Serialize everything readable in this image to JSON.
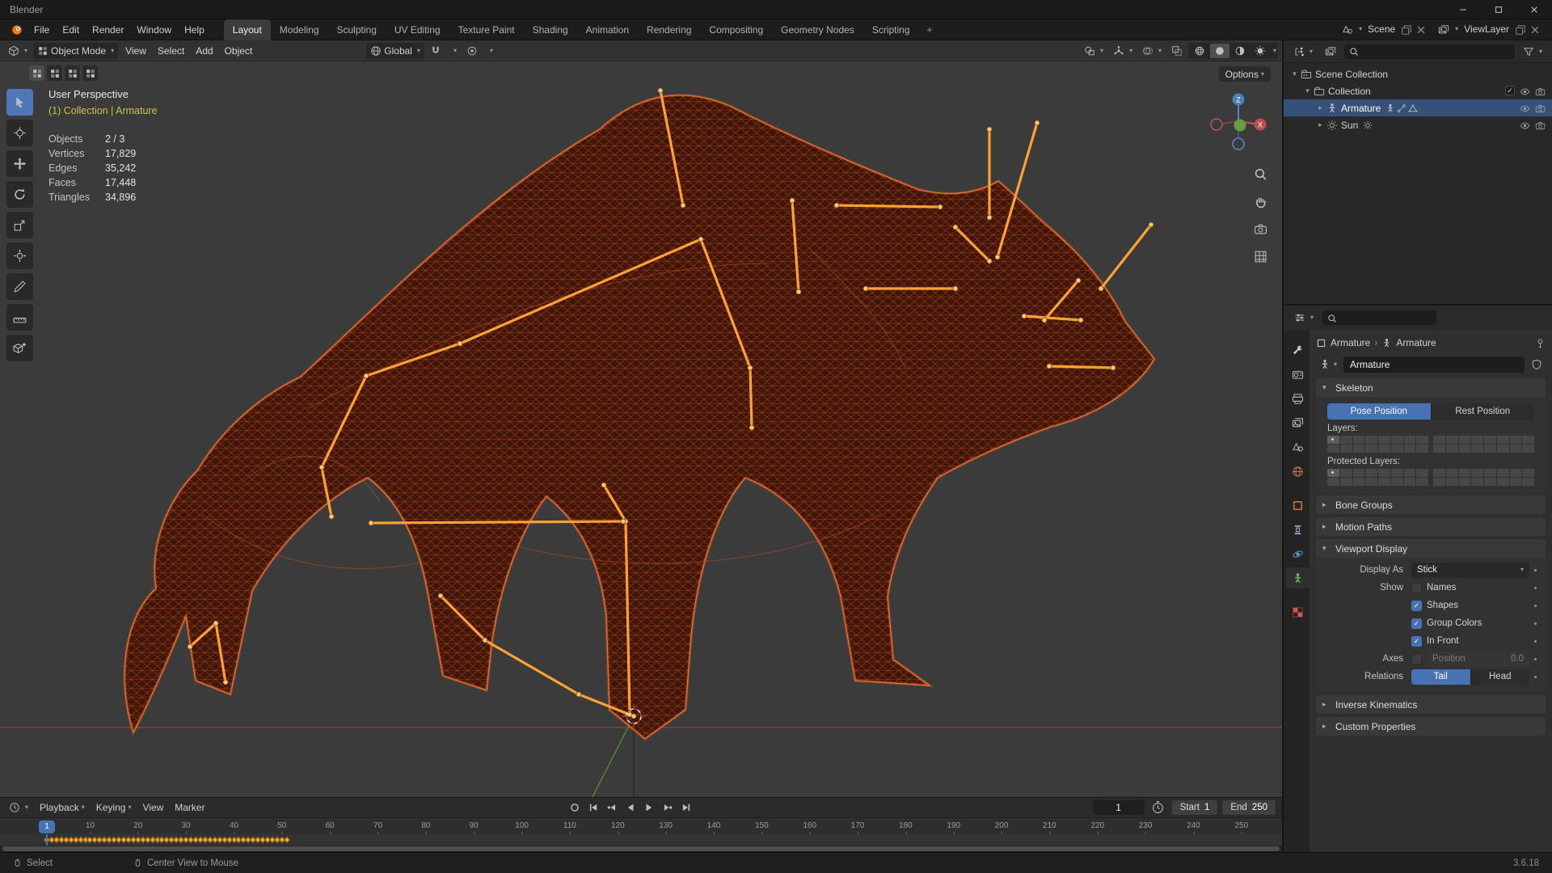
{
  "app": {
    "title": "Blender",
    "version": "3.6.18"
  },
  "colors": {
    "accent": "#4772b3",
    "wireframe": "#e0561f",
    "bone": "#ffa133",
    "context_highlight": "#cdc14c",
    "selection": "#35517a"
  },
  "topbar": {
    "menus": [
      "File",
      "Edit",
      "Render",
      "Window",
      "Help"
    ],
    "workspaces": [
      "Layout",
      "Modeling",
      "Sculpting",
      "UV Editing",
      "Texture Paint",
      "Shading",
      "Animation",
      "Rendering",
      "Compositing",
      "Geometry Nodes",
      "Scripting"
    ],
    "active_workspace": "Layout",
    "add_workspace_label": "+",
    "scene_selector": {
      "label": "Scene"
    },
    "viewlayer_selector": {
      "label": "ViewLayer"
    }
  },
  "viewport": {
    "header": {
      "mode": "Object Mode",
      "menus": [
        "View",
        "Select",
        "Add",
        "Object"
      ],
      "orientation": "Global",
      "options_label": "Options"
    },
    "overlay": {
      "view_name": "User Perspective",
      "context_path": "(1) Collection | Armature",
      "stats": [
        {
          "label": "Objects",
          "value": "2 / 3"
        },
        {
          "label": "Vertices",
          "value": "17,829"
        },
        {
          "label": "Edges",
          "value": "35,242"
        },
        {
          "label": "Faces",
          "value": "17,448"
        },
        {
          "label": "Triangles",
          "value": "34,896"
        }
      ]
    },
    "gizmo": {
      "z_label": "Z",
      "x_label": "X"
    },
    "tools": [
      "select-box",
      "cursor",
      "move",
      "rotate",
      "scale",
      "transform",
      "annotate",
      "measure",
      "add-cube"
    ],
    "active_tool": "select-box"
  },
  "outliner": {
    "rows": [
      {
        "label": "Scene Collection",
        "depth": 0,
        "icon": "scene-collection",
        "icon_color": "#d0d0d0",
        "caret": "down",
        "selected": false,
        "inline_icons": [],
        "controls": []
      },
      {
        "label": "Collection",
        "depth": 1,
        "icon": "collection",
        "icon_color": "#d0d0d0",
        "caret": "down",
        "selected": false,
        "inline_icons": [],
        "controls": [
          "checkbox",
          "eye",
          "camera"
        ]
      },
      {
        "label": "Armature",
        "depth": 2,
        "icon": "man",
        "icon_color": "#e8933a",
        "caret": "right",
        "selected": true,
        "inline_icons": [
          "man",
          "bone",
          "mesh-tri"
        ],
        "controls": [
          "eye",
          "camera"
        ]
      },
      {
        "label": "Sun",
        "depth": 2,
        "icon": "sun",
        "icon_color": "#cfae4a",
        "caret": "right",
        "selected": false,
        "inline_icons": [
          "sun"
        ],
        "controls": [
          "eye",
          "camera"
        ]
      }
    ]
  },
  "properties": {
    "breadcrumb": {
      "object": "Armature",
      "data": "Armature"
    },
    "name_value": "Armature",
    "tabs": [
      {
        "id": "tool",
        "icon": "wrench",
        "color": "#c6c6c6"
      },
      {
        "id": "render",
        "icon": "render-cam",
        "color": "#c6c6c6"
      },
      {
        "id": "output",
        "icon": "printer",
        "color": "#c6c6c6"
      },
      {
        "id": "view-layer",
        "icon": "photos",
        "color": "#c6c6c6"
      },
      {
        "id": "scene",
        "icon": "scene-ic",
        "color": "#c6c6c6"
      },
      {
        "id": "world",
        "icon": "globe",
        "color": "#cf7d52"
      },
      {
        "id": "object",
        "icon": "square",
        "color": "#e2873c",
        "gap": true
      },
      {
        "id": "constraints",
        "icon": "clamp",
        "color": "#aac6e4"
      },
      {
        "id": "physics",
        "icon": "orbit",
        "color": "#5e9dd4"
      },
      {
        "id": "data",
        "icon": "man",
        "color": "#6fc455",
        "active": true
      },
      {
        "id": "texture",
        "icon": "checker",
        "color": "#d4574e",
        "gap": true
      }
    ],
    "panels": {
      "skeleton": {
        "title": "Skeleton",
        "pose_label": "Pose Position",
        "rest_label": "Rest Position",
        "active_position": "Pose Position",
        "layers_label": "Layers:",
        "protected_layers_label": "Protected Layers:"
      },
      "bone_groups": {
        "title": "Bone Groups"
      },
      "motion_paths": {
        "title": "Motion Paths"
      },
      "viewport_display": {
        "title": "Viewport Display",
        "display_as_label": "Display As",
        "display_as_value": "Stick",
        "show_label": "Show",
        "checkboxes": [
          {
            "label": "Names",
            "checked": false
          },
          {
            "label": "Shapes",
            "checked": true
          },
          {
            "label": "Group Colors",
            "checked": true
          },
          {
            "label": "In Front",
            "checked": true
          }
        ],
        "axes_label": "Axes",
        "axes_checked": false,
        "position_label": "Position",
        "position_value": "0.0",
        "relations_label": "Relations",
        "tail_label": "Tail",
        "head_label": "Head",
        "relations_active": "Tail"
      },
      "inverse_kinematics": {
        "title": "Inverse Kinematics"
      },
      "custom_properties": {
        "title": "Custom Properties"
      }
    }
  },
  "timeline": {
    "menus": [
      "Playback",
      "Keying",
      "View",
      "Marker"
    ],
    "current_frame": "1",
    "start_label": "Start",
    "start_value": "1",
    "end_label": "End",
    "end_value": "250",
    "ticks": [
      10,
      20,
      30,
      40,
      50,
      60,
      70,
      80,
      90,
      100,
      110,
      120,
      130,
      140,
      150,
      160,
      170,
      180,
      190,
      200,
      210,
      220,
      230,
      240,
      250
    ],
    "frame_min": 1,
    "frame_max": 250,
    "keyframes": {
      "from": 1,
      "to": 51
    }
  },
  "statusbar": {
    "items": [
      "Select",
      "Center View to Mouse"
    ],
    "version": "3.6.18"
  }
}
